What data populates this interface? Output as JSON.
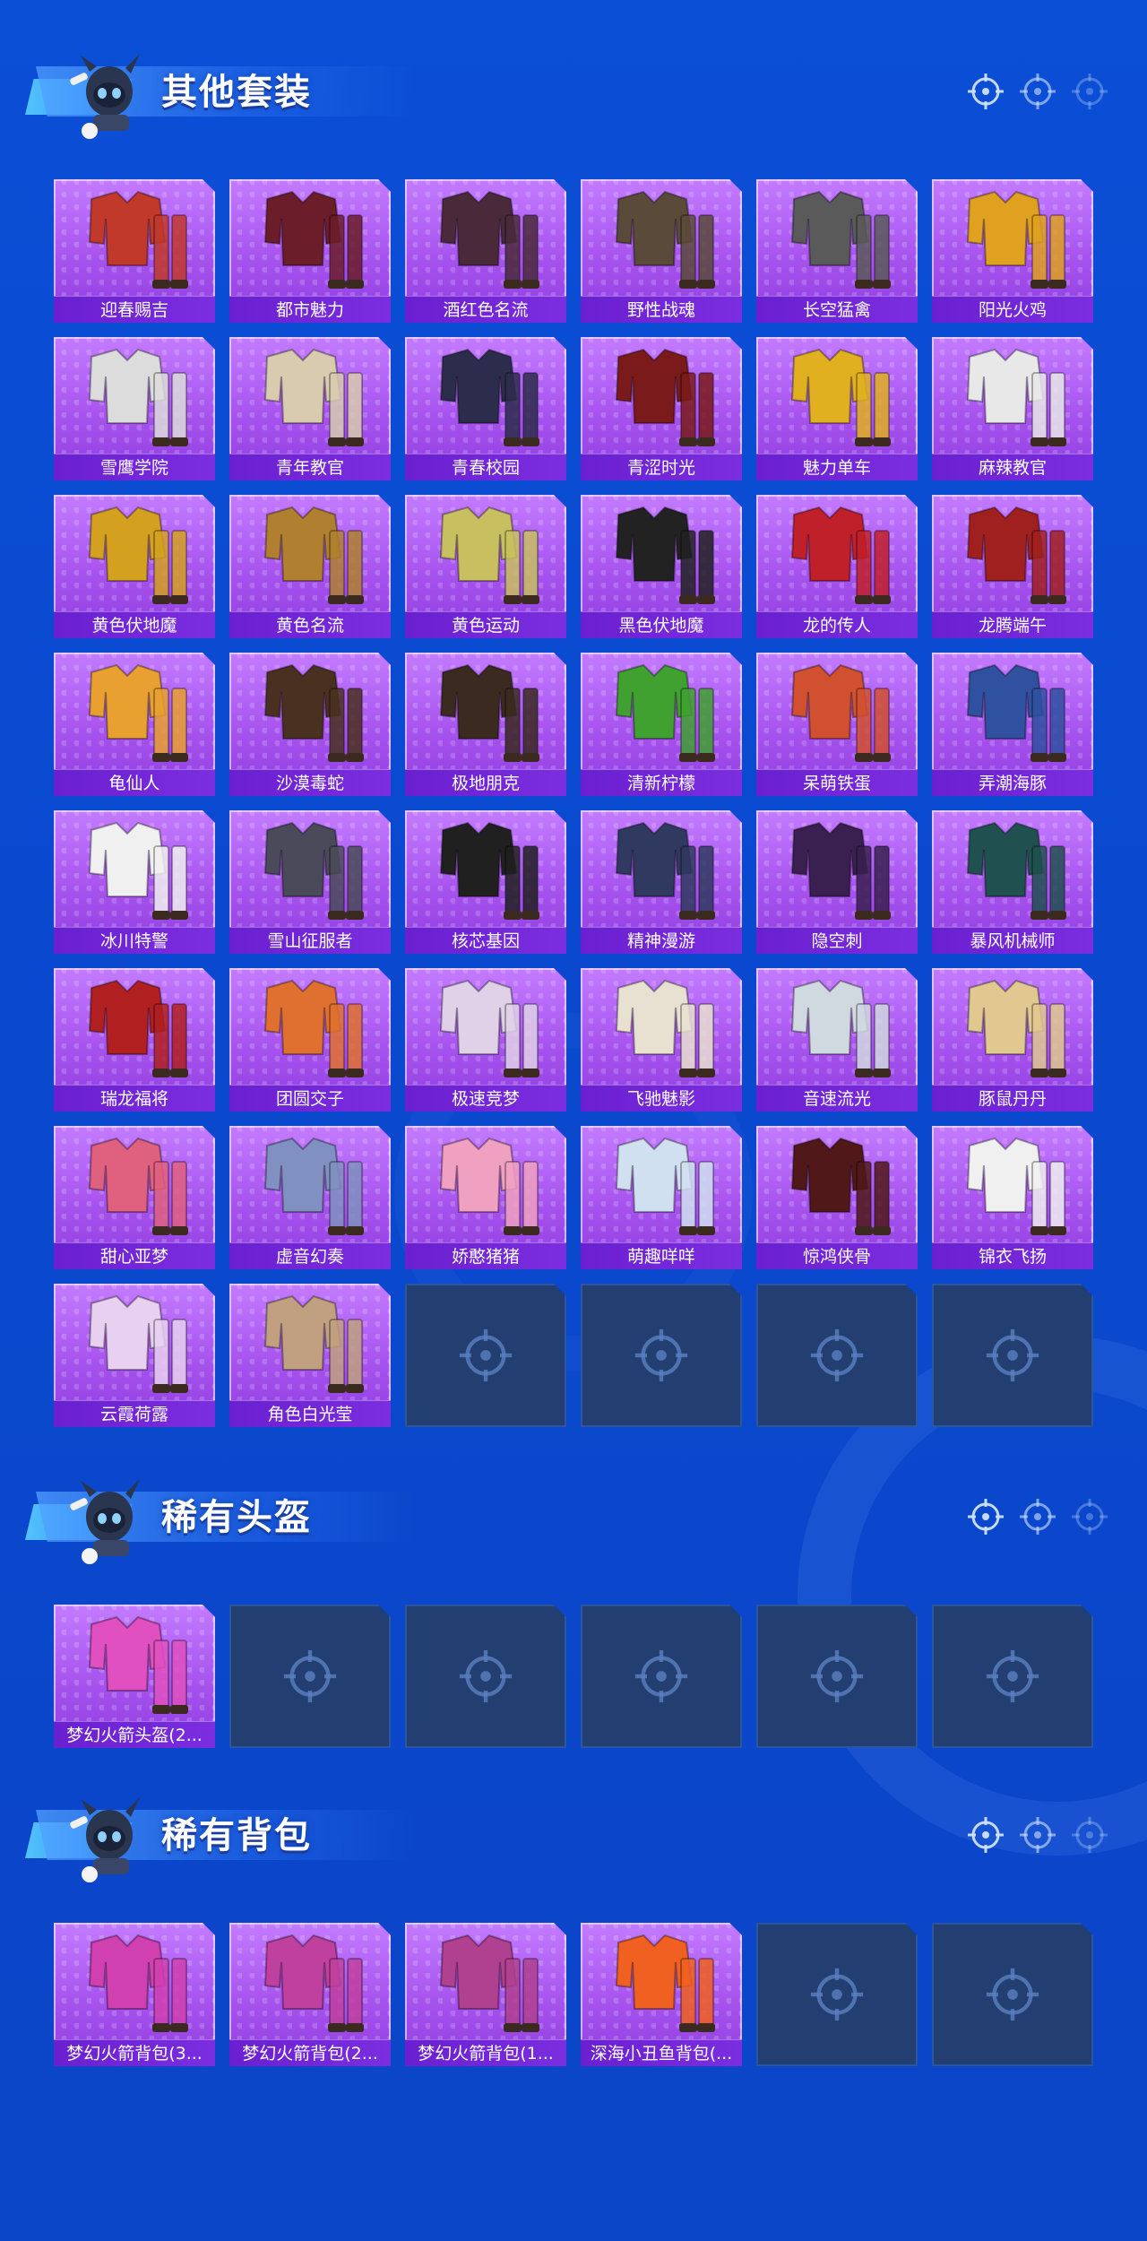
{
  "sections": [
    {
      "title": "其他套装",
      "items": [
        {
          "label": "迎春赐吉",
          "hue": "#c0392b"
        },
        {
          "label": "都市魅力",
          "hue": "#6b1d2a"
        },
        {
          "label": "酒红色名流",
          "hue": "#4a2a3a"
        },
        {
          "label": "野性战魂",
          "hue": "#5a4a3a"
        },
        {
          "label": "长空猛禽",
          "hue": "#5a5a5a"
        },
        {
          "label": "阳光火鸡",
          "hue": "#e0a020"
        },
        {
          "label": "雪鹰学院",
          "hue": "#dcdcdc"
        },
        {
          "label": "青年教官",
          "hue": "#d8cbb0"
        },
        {
          "label": "青春校园",
          "hue": "#2c2c4c"
        },
        {
          "label": "青涩时光",
          "hue": "#7a1a1a"
        },
        {
          "label": "魅力单车",
          "hue": "#e0b020"
        },
        {
          "label": "麻辣教官",
          "hue": "#e8e8e8"
        },
        {
          "label": "黄色伏地魔",
          "hue": "#d4a020"
        },
        {
          "label": "黄色名流",
          "hue": "#b08030"
        },
        {
          "label": "黄色运动",
          "hue": "#c8c060"
        },
        {
          "label": "黑色伏地魔",
          "hue": "#222222"
        },
        {
          "label": "龙的传人",
          "hue": "#c0202a"
        },
        {
          "label": "龙腾端午",
          "hue": "#a02020"
        },
        {
          "label": "龟仙人",
          "hue": "#e8a030"
        },
        {
          "label": "沙漠毒蛇",
          "hue": "#4a3020"
        },
        {
          "label": "极地朋克",
          "hue": "#3a2a20"
        },
        {
          "label": "清新柠檬",
          "hue": "#40a030"
        },
        {
          "label": "呆萌铁蛋",
          "hue": "#d05030"
        },
        {
          "label": "弄潮海豚",
          "hue": "#3050a0"
        },
        {
          "label": "冰川特警",
          "hue": "#f0f0f0"
        },
        {
          "label": "雪山征服者",
          "hue": "#4a4a5a"
        },
        {
          "label": "核芯基因",
          "hue": "#202020"
        },
        {
          "label": "精神漫游",
          "hue": "#303a60"
        },
        {
          "label": "隐空刺",
          "hue": "#3a2050"
        },
        {
          "label": "暴风机械师",
          "hue": "#205050"
        },
        {
          "label": "瑞龙福将",
          "hue": "#b02020"
        },
        {
          "label": "团圆交子",
          "hue": "#e07030"
        },
        {
          "label": "极速竞梦",
          "hue": "#e0d0e8"
        },
        {
          "label": "飞驰魅影",
          "hue": "#e8e0d0"
        },
        {
          "label": "音速流光",
          "hue": "#d0d8e0"
        },
        {
          "label": "豚鼠丹丹",
          "hue": "#e0c890"
        },
        {
          "label": "甜心亚梦",
          "hue": "#e06080"
        },
        {
          "label": "虚音幻奏",
          "hue": "#8090c0"
        },
        {
          "label": "娇憨猪猪",
          "hue": "#f0a0c0"
        },
        {
          "label": "萌趣咩咩",
          "hue": "#d0e0f0"
        },
        {
          "label": "惊鸿侠骨",
          "hue": "#501818"
        },
        {
          "label": "锦衣飞扬",
          "hue": "#f0f0f0"
        },
        {
          "label": "云霞荷露",
          "hue": "#e8d0f0"
        },
        {
          "label": "角色白光莹",
          "hue": "#c0a080"
        }
      ],
      "empty_slots": 4
    },
    {
      "title": "稀有头盔",
      "items": [
        {
          "label": "梦幻火箭头盔(2...",
          "hue": "#e050c0"
        }
      ],
      "empty_slots": 5
    },
    {
      "title": "稀有背包",
      "items": [
        {
          "label": "梦幻火箭背包(3...",
          "hue": "#d040b0"
        },
        {
          "label": "梦幻火箭背包(2...",
          "hue": "#c040a0"
        },
        {
          "label": "梦幻火箭背包(1...",
          "hue": "#b04090"
        },
        {
          "label": "深海小丑鱼背包(...",
          "hue": "#f06020"
        }
      ],
      "empty_slots": 2
    }
  ],
  "icons": {
    "header_targets": [
      "crosshair-icon",
      "crosshair-icon",
      "crosshair-icon"
    ],
    "empty_slot": "crosshair-icon",
    "mascot": "mascot-icon"
  },
  "colors": {
    "background": "#0b4fd6",
    "card_filled": "#b05cf0",
    "card_label": "#6a1fd0",
    "card_empty": "#233f72"
  }
}
